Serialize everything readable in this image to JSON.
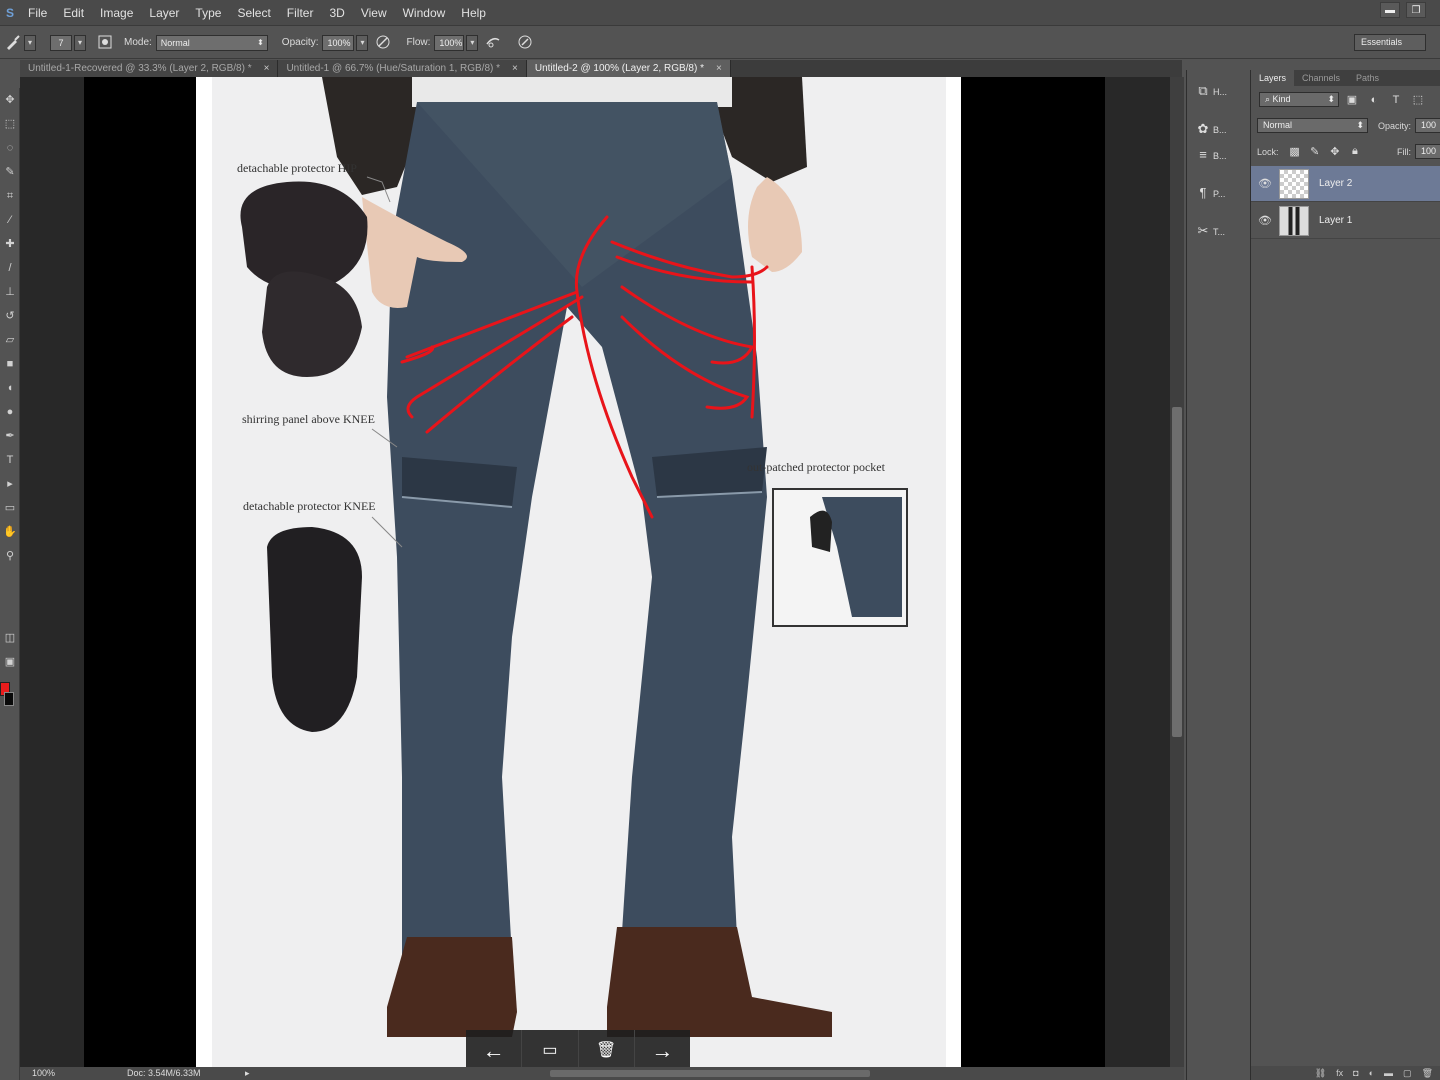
{
  "app": {
    "logo": "S"
  },
  "menu": [
    "File",
    "Edit",
    "Image",
    "Layer",
    "Type",
    "Select",
    "Filter",
    "3D",
    "View",
    "Window",
    "Help"
  ],
  "window_controls": {
    "minimize": "▬",
    "restore": "❐"
  },
  "options_bar": {
    "brush_size": "7",
    "mode_label": "Mode:",
    "mode_value": "Normal",
    "opacity_label": "Opacity:",
    "opacity_value": "100%",
    "flow_label": "Flow:",
    "flow_value": "100%",
    "workspace": "Essentials"
  },
  "tabs": [
    {
      "label": "Untitled-1-Recovered @ 33.3% (Layer 2, RGB/8) *",
      "close": "×"
    },
    {
      "label": "Untitled-1 @ 66.7% (Hue/Saturation 1, RGB/8) *",
      "close": "×"
    },
    {
      "label": "Untitled-2 @ 100% (Layer 2, RGB/8) *",
      "close": "×"
    }
  ],
  "annotations": {
    "hip": "detachable protector HIP",
    "shirring": "shirring panel above KNEE",
    "knee": "detachable protector KNEE",
    "pocket": "out-patched protector pocket"
  },
  "nav": {
    "prev": "←",
    "slides": "▭",
    "delete": "🗑",
    "next": "→"
  },
  "status": {
    "zoom": "100%",
    "doc": "Doc: 3.54M/6.33M"
  },
  "dock": [
    {
      "label": "H...",
      "icon": "history-icon"
    },
    {
      "label": "B...",
      "icon": "brush-icon"
    },
    {
      "label": "B...",
      "icon": "brush-presets-icon"
    },
    {
      "label": "P...",
      "icon": "paragraph-icon"
    },
    {
      "label": "T...",
      "icon": "tool-presets-icon"
    }
  ],
  "layers_panel": {
    "tabs": [
      "Layers",
      "Channels",
      "Paths"
    ],
    "kind_filter": "Kind",
    "blend_mode": "Normal",
    "opacity_label": "Opacity:",
    "opacity_value": "100",
    "lock_label": "Lock:",
    "fill_label": "Fill:",
    "fill_value": "100",
    "layers": [
      {
        "name": "Layer 2",
        "selected": true
      },
      {
        "name": "Layer 1",
        "selected": false
      }
    ]
  },
  "colors": {
    "foreground": "#e81c1c",
    "background": "#0a0a0a",
    "selection": "#6d7a96",
    "stroke": "#e8141a"
  }
}
